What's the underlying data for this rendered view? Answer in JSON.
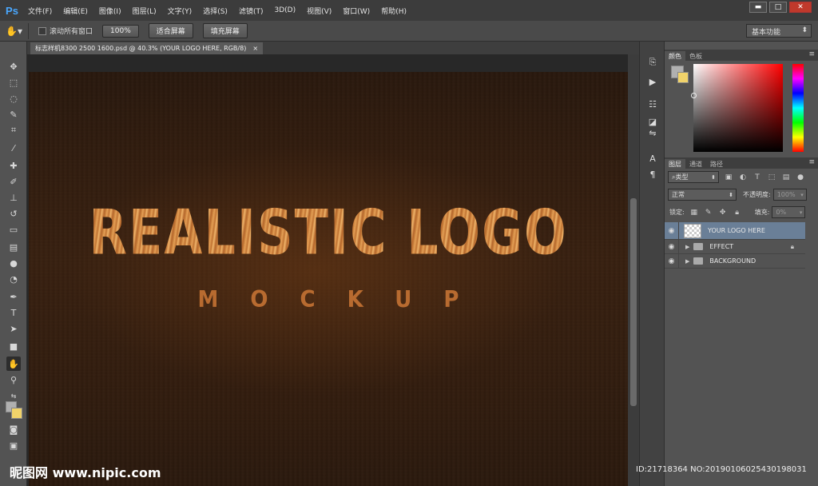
{
  "app": {
    "logo": "Ps"
  },
  "menu": [
    "文件(F)",
    "编辑(E)",
    "图像(I)",
    "图层(L)",
    "文字(Y)",
    "选择(S)",
    "滤镜(T)",
    "3D(D)",
    "视图(V)",
    "窗口(W)",
    "帮助(H)"
  ],
  "window_controls": {
    "minimize": "▬",
    "restore": "□",
    "close": "✕"
  },
  "options": {
    "scroll_all_windows": "滚动所有窗口",
    "zoom_100": "100%",
    "fit_screen": "适合屏幕",
    "fill_screen": "填充屏幕",
    "workspace": "基本功能"
  },
  "document": {
    "tab_title": "标志样机8300 2500 1600.psd @ 40.3% (YOUR LOGO HERE, RGB/8)",
    "close": "×"
  },
  "canvas": {
    "title": "REALISTIC LOGO",
    "subtitle": "MOCKUP"
  },
  "color_panel": {
    "tabs": [
      "颜色",
      "色板"
    ],
    "fg_color": "#b0b0b0",
    "bg_color": "#f1d36a"
  },
  "layers_panel": {
    "tabs": [
      "图层",
      "通道",
      "路径"
    ],
    "filter_kind": "类型",
    "blend_mode": "正常",
    "opacity_label": "不透明度:",
    "opacity_value": "100%",
    "lock_label": "锁定:",
    "fill_label": "填充:",
    "fill_value": "0%",
    "layers": [
      {
        "name": "YOUR LOGO HERE",
        "type": "smart-object",
        "selected": true
      },
      {
        "name": "EFFECT",
        "type": "group",
        "locked": true
      },
      {
        "name": "BACKGROUND",
        "type": "group"
      }
    ]
  },
  "watermark": {
    "left": "昵图网 www.nipic.com",
    "right": "ID:21718364 NO:20190106025430198031"
  }
}
